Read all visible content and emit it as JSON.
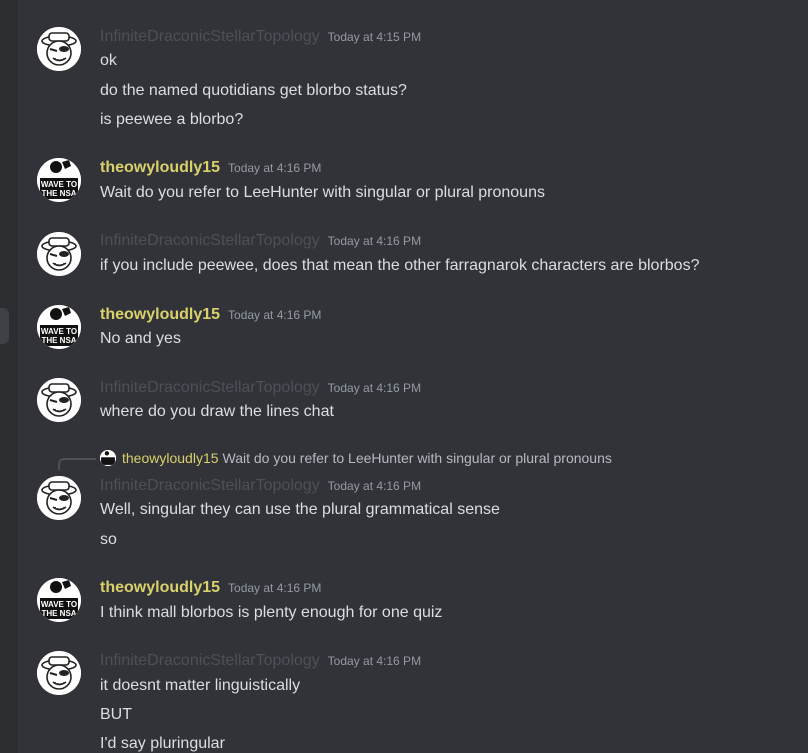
{
  "colors": {
    "background": "#313338",
    "author_dim": "#4e5058",
    "author_yellow": "#d9d16b",
    "timestamp": "#949ba4",
    "text": "#dbdee1"
  },
  "icons": {
    "user_a_avatar": "cartoon-face-with-hat-avatar",
    "user_b_avatar": "wave-to-the-nsa-avatar"
  },
  "messages": [
    {
      "author": "InfiniteDraconicStellarTopology",
      "timestamp": "Today at 4:15 PM",
      "lines": [
        "ok",
        "do the named quotidians get blorbo status?",
        "is peewee a blorbo?"
      ]
    },
    {
      "author": "theowyloudly15",
      "avatar_text_1": "WAVE TO",
      "avatar_text_2": "THE NSA",
      "timestamp": "Today at 4:16 PM",
      "lines": [
        "Wait do you refer to LeeHunter with singular or plural pronouns"
      ]
    },
    {
      "author": "InfiniteDraconicStellarTopology",
      "timestamp": "Today at 4:16 PM",
      "lines": [
        "if you include peewee, does that mean the other farragnarok characters are blorbos?"
      ]
    },
    {
      "author": "theowyloudly15",
      "avatar_text_1": "WAVE TO",
      "avatar_text_2": "THE NSA",
      "timestamp": "Today at 4:16 PM",
      "lines": [
        "No and yes"
      ]
    },
    {
      "author": "InfiniteDraconicStellarTopology",
      "timestamp": "Today at 4:16 PM",
      "lines": [
        "where do you draw the lines chat"
      ]
    },
    {
      "author": "InfiniteDraconicStellarTopology",
      "timestamp": "Today at 4:16 PM",
      "reply": {
        "author": "theowyloudly15",
        "text": "Wait do you refer to LeeHunter with singular or plural pronouns"
      },
      "lines": [
        "Well, singular they can use the plural grammatical sense",
        "so"
      ]
    },
    {
      "author": "theowyloudly15",
      "avatar_text_1": "WAVE TO",
      "avatar_text_2": "THE NSA",
      "timestamp": "Today at 4:16 PM",
      "lines": [
        "I think mall blorbos is plenty enough for one quiz"
      ]
    },
    {
      "author": "InfiniteDraconicStellarTopology",
      "timestamp": "Today at 4:16 PM",
      "lines": [
        "it doesnt matter linguistically",
        "BUT",
        "I'd say pluringular"
      ]
    }
  ]
}
